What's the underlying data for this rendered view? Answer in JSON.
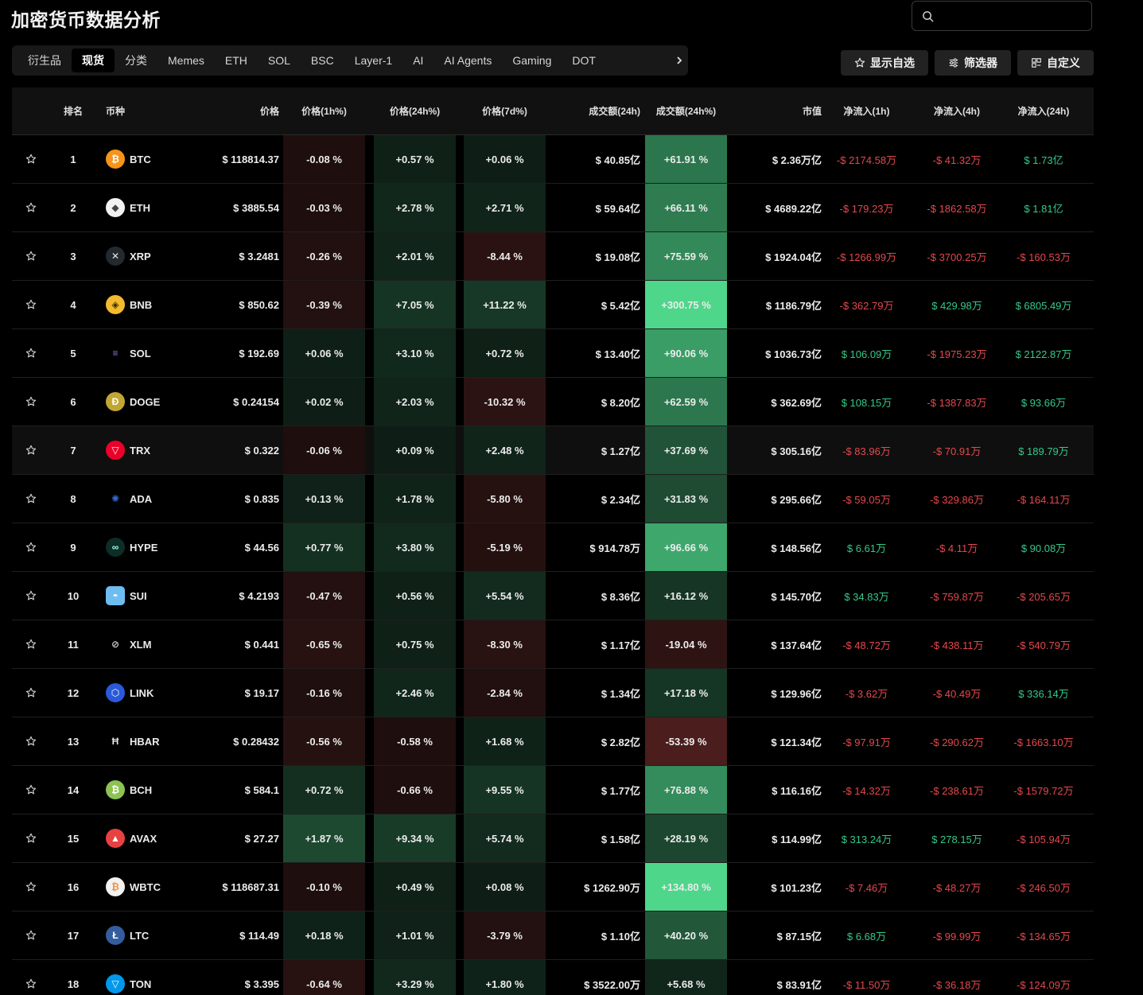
{
  "title": "加密货币数据分析",
  "search": {
    "placeholder": ""
  },
  "tabs": [
    {
      "label": "衍生品",
      "active": false
    },
    {
      "label": "现货",
      "active": true
    },
    {
      "label": "分类",
      "active": false
    },
    {
      "label": "Memes",
      "active": false
    },
    {
      "label": "ETH",
      "active": false
    },
    {
      "label": "SOL",
      "active": false
    },
    {
      "label": "BSC",
      "active": false
    },
    {
      "label": "Layer-1",
      "active": false
    },
    {
      "label": "AI",
      "active": false
    },
    {
      "label": "AI Agents",
      "active": false
    },
    {
      "label": "Gaming",
      "active": false
    },
    {
      "label": "DOT",
      "active": false
    }
  ],
  "toolbar": {
    "watchlist": "显示自选",
    "filter": "筛选器",
    "customize": "自定义"
  },
  "columns": {
    "rank": "排名",
    "coin": "币种",
    "price": "价格",
    "h1": "价格(1h%)",
    "h24": "价格(24h%)",
    "d7": "价格(7d%)",
    "vol": "成交额(24h)",
    "vc": "成交额(24h%)",
    "cap": "市值",
    "f1": "净流入(1h)",
    "f4": "净流入(4h)",
    "f24": "净流入(24h)"
  },
  "colors": {
    "positive": "#35c98a",
    "negative": "#e5484d",
    "background": "#000000"
  },
  "rows": [
    {
      "rank": "1",
      "symbol": "BTC",
      "icon": "btc-icon",
      "price": "$ 118814.37",
      "h1": "-0.08 %",
      "h24": "+0.57 %",
      "d7": "+0.06 %",
      "vol": "$ 40.85亿",
      "vc": "+61.91 %",
      "cap": "$ 2.36万亿",
      "f1": "-$ 2174.58万",
      "f4": "-$ 41.32万",
      "f24": "$ 1.73亿"
    },
    {
      "rank": "2",
      "symbol": "ETH",
      "icon": "eth-icon",
      "price": "$ 3885.54",
      "h1": "-0.03 %",
      "h24": "+2.78 %",
      "d7": "+2.71 %",
      "vol": "$ 59.64亿",
      "vc": "+66.11 %",
      "cap": "$ 4689.22亿",
      "f1": "-$ 179.23万",
      "f4": "-$ 1862.58万",
      "f24": "$ 1.81亿"
    },
    {
      "rank": "3",
      "symbol": "XRP",
      "icon": "xrp-icon",
      "price": "$ 3.2481",
      "h1": "-0.26 %",
      "h24": "+2.01 %",
      "d7": "-8.44 %",
      "vol": "$ 19.08亿",
      "vc": "+75.59 %",
      "cap": "$ 1924.04亿",
      "f1": "-$ 1266.99万",
      "f4": "-$ 3700.25万",
      "f24": "-$ 160.53万"
    },
    {
      "rank": "4",
      "symbol": "BNB",
      "icon": "bnb-icon",
      "price": "$ 850.62",
      "h1": "-0.39 %",
      "h24": "+7.05 %",
      "d7": "+11.22 %",
      "vol": "$ 5.42亿",
      "vc": "+300.75 %",
      "cap": "$ 1186.79亿",
      "f1": "-$ 362.79万",
      "f4": "$ 429.98万",
      "f24": "$ 6805.49万"
    },
    {
      "rank": "5",
      "symbol": "SOL",
      "icon": "sol-icon",
      "price": "$ 192.69",
      "h1": "+0.06 %",
      "h24": "+3.10 %",
      "d7": "+0.72 %",
      "vol": "$ 13.40亿",
      "vc": "+90.06 %",
      "cap": "$ 1036.73亿",
      "f1": "$ 106.09万",
      "f4": "-$ 1975.23万",
      "f24": "$ 2122.87万"
    },
    {
      "rank": "6",
      "symbol": "DOGE",
      "icon": "doge-icon",
      "price": "$ 0.24154",
      "h1": "+0.02 %",
      "h24": "+2.03 %",
      "d7": "-10.32 %",
      "vol": "$ 8.20亿",
      "vc": "+62.59 %",
      "cap": "$ 362.69亿",
      "f1": "$ 108.15万",
      "f4": "-$ 1387.83万",
      "f24": "$ 93.66万"
    },
    {
      "rank": "7",
      "symbol": "TRX",
      "icon": "trx-icon",
      "price": "$ 0.322",
      "h1": "-0.06 %",
      "h24": "+0.09 %",
      "d7": "+2.48 %",
      "vol": "$ 1.27亿",
      "vc": "+37.69 %",
      "cap": "$ 305.16亿",
      "f1": "-$ 83.96万",
      "f4": "-$ 70.91万",
      "f24": "$ 189.79万"
    },
    {
      "rank": "8",
      "symbol": "ADA",
      "icon": "ada-icon",
      "price": "$ 0.835",
      "h1": "+0.13 %",
      "h24": "+1.78 %",
      "d7": "-5.80 %",
      "vol": "$ 2.34亿",
      "vc": "+31.83 %",
      "cap": "$ 295.66亿",
      "f1": "-$ 59.05万",
      "f4": "-$ 329.86万",
      "f24": "-$ 164.11万"
    },
    {
      "rank": "9",
      "symbol": "HYPE",
      "icon": "hype-icon",
      "price": "$ 44.56",
      "h1": "+0.77 %",
      "h24": "+3.80 %",
      "d7": "-5.19 %",
      "vol": "$ 914.78万",
      "vc": "+96.66 %",
      "cap": "$ 148.56亿",
      "f1": "$ 6.61万",
      "f4": "-$ 4.11万",
      "f24": "$ 90.08万"
    },
    {
      "rank": "10",
      "symbol": "SUI",
      "icon": "sui-icon",
      "price": "$ 4.2193",
      "h1": "-0.47 %",
      "h24": "+0.56 %",
      "d7": "+5.54 %",
      "vol": "$ 8.36亿",
      "vc": "+16.12 %",
      "cap": "$ 145.70亿",
      "f1": "$ 34.83万",
      "f4": "-$ 759.87万",
      "f24": "-$ 205.65万"
    },
    {
      "rank": "11",
      "symbol": "XLM",
      "icon": "xlm-icon",
      "price": "$ 0.441",
      "h1": "-0.65 %",
      "h24": "+0.75 %",
      "d7": "-8.30 %",
      "vol": "$ 1.17亿",
      "vc": "-19.04 %",
      "cap": "$ 137.64亿",
      "f1": "-$ 48.72万",
      "f4": "-$ 438.11万",
      "f24": "-$ 540.79万"
    },
    {
      "rank": "12",
      "symbol": "LINK",
      "icon": "link-icon",
      "price": "$ 19.17",
      "h1": "-0.16 %",
      "h24": "+2.46 %",
      "d7": "-2.84 %",
      "vol": "$ 1.34亿",
      "vc": "+17.18 %",
      "cap": "$ 129.96亿",
      "f1": "-$ 3.62万",
      "f4": "-$ 40.49万",
      "f24": "$ 336.14万"
    },
    {
      "rank": "13",
      "symbol": "HBAR",
      "icon": "hbar-icon",
      "price": "$ 0.28432",
      "h1": "-0.56 %",
      "h24": "-0.58 %",
      "d7": "+1.68 %",
      "vol": "$ 2.82亿",
      "vc": "-53.39 %",
      "cap": "$ 121.34亿",
      "f1": "-$ 97.91万",
      "f4": "-$ 290.62万",
      "f24": "-$ 1663.10万"
    },
    {
      "rank": "14",
      "symbol": "BCH",
      "icon": "bch-icon",
      "price": "$ 584.1",
      "h1": "+0.72 %",
      "h24": "-0.66 %",
      "d7": "+9.55 %",
      "vol": "$ 1.77亿",
      "vc": "+76.88 %",
      "cap": "$ 116.16亿",
      "f1": "-$ 14.32万",
      "f4": "-$ 238.61万",
      "f24": "-$ 1579.72万"
    },
    {
      "rank": "15",
      "symbol": "AVAX",
      "icon": "avax-icon",
      "price": "$ 27.27",
      "h1": "+1.87 %",
      "h24": "+9.34 %",
      "d7": "+5.74 %",
      "vol": "$ 1.58亿",
      "vc": "+28.19 %",
      "cap": "$ 114.99亿",
      "f1": "$ 313.24万",
      "f4": "$ 278.15万",
      "f24": "-$ 105.94万"
    },
    {
      "rank": "16",
      "symbol": "WBTC",
      "icon": "wbtc-icon",
      "price": "$ 118687.31",
      "h1": "-0.10 %",
      "h24": "+0.49 %",
      "d7": "+0.08 %",
      "vol": "$ 1262.90万",
      "vc": "+134.80 %",
      "cap": "$ 101.23亿",
      "f1": "-$ 7.46万",
      "f4": "-$ 48.27万",
      "f24": "-$ 246.50万"
    },
    {
      "rank": "17",
      "symbol": "LTC",
      "icon": "ltc-icon",
      "price": "$ 114.49",
      "h1": "+0.18 %",
      "h24": "+1.01 %",
      "d7": "-3.79 %",
      "vol": "$ 1.10亿",
      "vc": "+40.20 %",
      "cap": "$ 87.15亿",
      "f1": "$ 6.68万",
      "f4": "-$ 99.99万",
      "f24": "-$ 134.65万"
    },
    {
      "rank": "18",
      "symbol": "TON",
      "icon": "ton-icon",
      "price": "$ 3.395",
      "h1": "-0.64 %",
      "h24": "+3.29 %",
      "d7": "+1.80 %",
      "vol": "$ 3522.00万",
      "vc": "+5.68 %",
      "cap": "$ 83.91亿",
      "f1": "-$ 11.50万",
      "f4": "-$ 36.18万",
      "f24": "-$ 124.09万"
    }
  ]
}
